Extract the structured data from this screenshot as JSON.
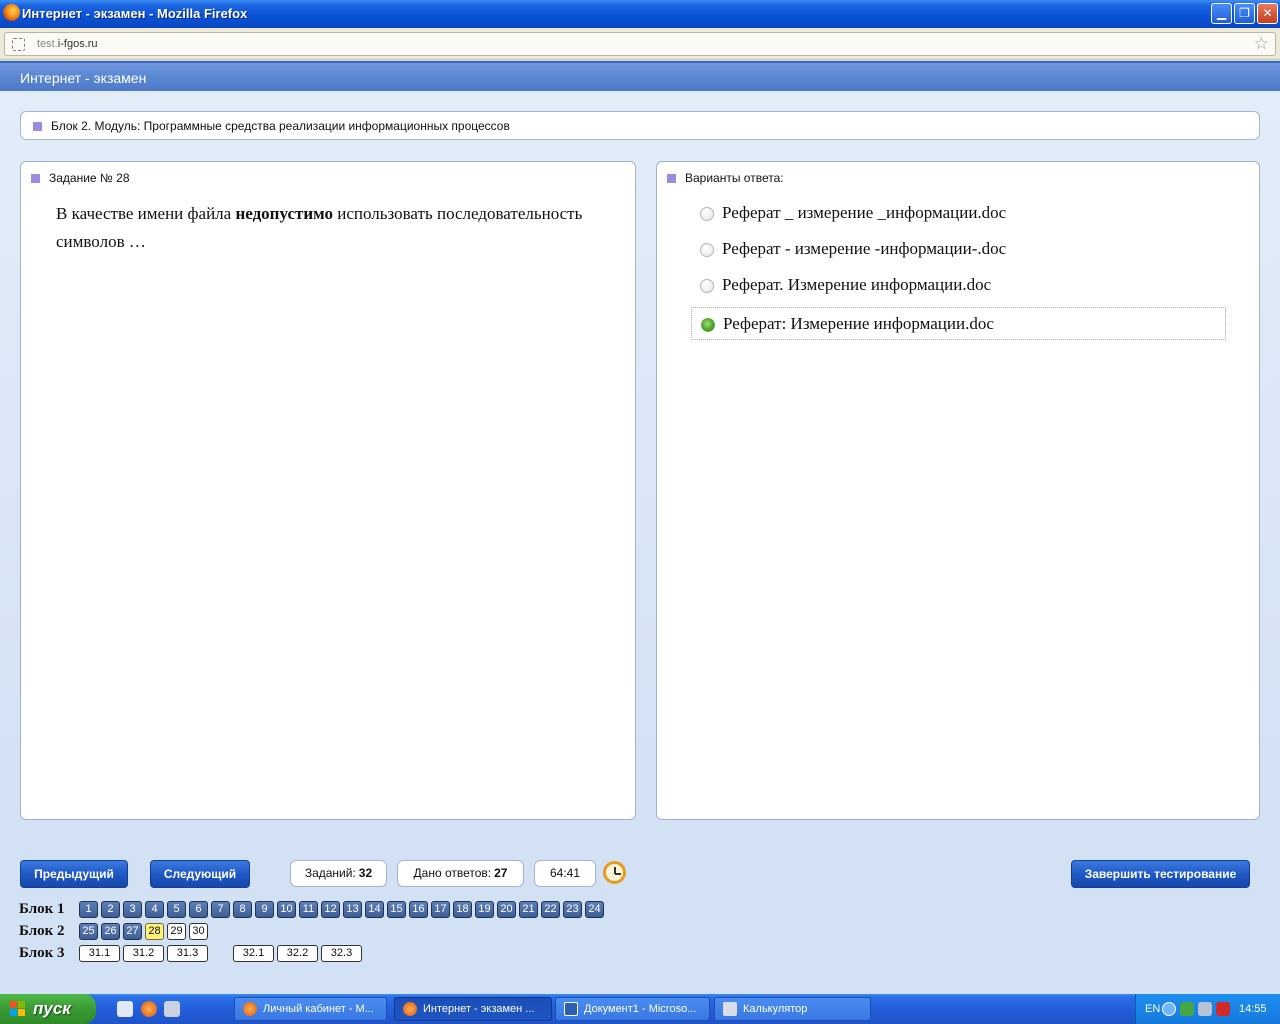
{
  "window": {
    "title": "Интернет - экзамен - Mozilla Firefox",
    "url_host_prefix": "test.",
    "url_host": "i-fgos.ru"
  },
  "page": {
    "header": "Интернет - экзамен",
    "block_title": "Блок 2. Модуль: Программные средства реализации информационных процессов"
  },
  "question": {
    "title": "Задание № 28",
    "text_before": "В качестве имени файла ",
    "text_bold": "недопустимо",
    "text_after": " использовать последовательность символов …"
  },
  "answers": {
    "title": "Варианты ответа:",
    "options": [
      {
        "label": "Реферат _ измерение _информации.doc",
        "selected": false
      },
      {
        "label": "Реферат - измерение -информации-.doc",
        "selected": false
      },
      {
        "label": "Реферат. Измерение информации.doc",
        "selected": false
      },
      {
        "label": "Реферат: Измерение информации.doc",
        "selected": true
      }
    ]
  },
  "controls": {
    "prev_label": "Предыдущий",
    "next_label": "Следующий",
    "tasks_label": "Заданий:",
    "tasks_count": "32",
    "answers_label": "Дано ответов:",
    "answers_count": "27",
    "timer": "64:41",
    "finish_label": "Завершить тестирование"
  },
  "blocks": [
    {
      "label": "Блок 1",
      "items": [
        "1",
        "2",
        "3",
        "4",
        "5",
        "6",
        "7",
        "8",
        "9",
        "10",
        "11",
        "12",
        "13",
        "14",
        "15",
        "16",
        "17",
        "18",
        "19",
        "20",
        "21",
        "22",
        "23",
        "24"
      ]
    },
    {
      "label": "Блок 2",
      "items": [
        "25",
        "26",
        "27",
        "28",
        "29",
        "30"
      ],
      "current": "28",
      "unanswered": [
        "29",
        "30"
      ]
    },
    {
      "label": "Блок 3",
      "items": [
        "31.1",
        "31.2",
        "31.3",
        "32.1",
        "32.2",
        "32.3"
      ]
    }
  ],
  "taskbar": {
    "start_label": "пуск",
    "tasks": [
      {
        "label": "Личный кабинет - M...",
        "icon": "firefox-icon",
        "active": false
      },
      {
        "label": "Интернет - экзамен ...",
        "icon": "firefox-icon",
        "active": true
      },
      {
        "label": "Документ1 - Microso...",
        "icon": "word-icon",
        "active": false
      },
      {
        "label": "Калькулятор",
        "icon": "calculator-icon",
        "active": false
      }
    ],
    "lang": "EN",
    "time": "14:55"
  },
  "colors": {
    "accent_blue": "#1d56c2",
    "selected_radio": "#4fa82a",
    "current_question": "#fff27a",
    "marker": "#9c8bde"
  }
}
